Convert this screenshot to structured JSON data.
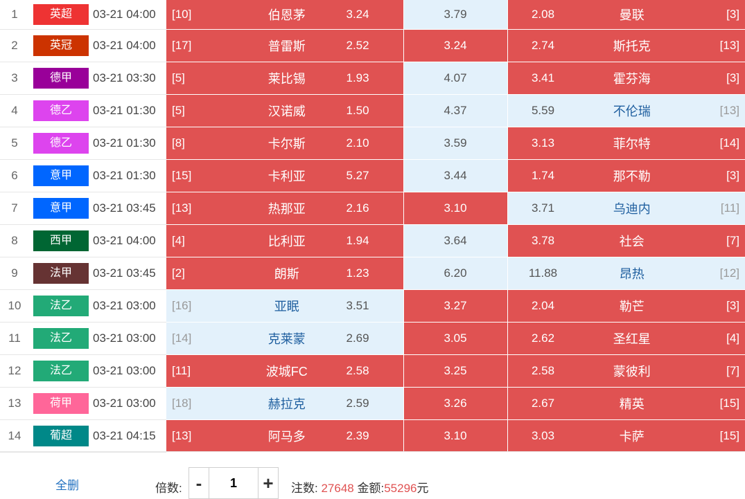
{
  "matches": [
    {
      "index": "1",
      "league": "英超",
      "league_color": "#ee3333",
      "time": "03-21 04:00",
      "home_rank": "[10]",
      "home": "伯恩茅",
      "home_odds": "3.24",
      "draw_odds": "3.79",
      "away_odds": "2.08",
      "away": "曼联",
      "away_rank": "[3]",
      "home_on": true,
      "draw_on": false,
      "away_on": true
    },
    {
      "index": "2",
      "league": "英冠",
      "league_color": "#cc3300",
      "time": "03-21 04:00",
      "home_rank": "[17]",
      "home": "普雷斯",
      "home_odds": "2.52",
      "draw_odds": "3.24",
      "away_odds": "2.74",
      "away": "斯托克",
      "away_rank": "[13]",
      "home_on": true,
      "draw_on": true,
      "away_on": true
    },
    {
      "index": "3",
      "league": "德甲",
      "league_color": "#990099",
      "time": "03-21 03:30",
      "home_rank": "[5]",
      "home": "莱比锡",
      "home_odds": "1.93",
      "draw_odds": "4.07",
      "away_odds": "3.41",
      "away": "霍芬海",
      "away_rank": "[3]",
      "home_on": true,
      "draw_on": false,
      "away_on": true
    },
    {
      "index": "4",
      "league": "德乙",
      "league_color": "#dd44ee",
      "time": "03-21 01:30",
      "home_rank": "[5]",
      "home": "汉诺威",
      "home_odds": "1.50",
      "draw_odds": "4.37",
      "away_odds": "5.59",
      "away": "不伦瑞",
      "away_rank": "[13]",
      "home_on": true,
      "draw_on": false,
      "away_on": false
    },
    {
      "index": "5",
      "league": "德乙",
      "league_color": "#dd44ee",
      "time": "03-21 01:30",
      "home_rank": "[8]",
      "home": "卡尔斯",
      "home_odds": "2.10",
      "draw_odds": "3.59",
      "away_odds": "3.13",
      "away": "菲尔特",
      "away_rank": "[14]",
      "home_on": true,
      "draw_on": false,
      "away_on": true
    },
    {
      "index": "6",
      "league": "意甲",
      "league_color": "#0066ff",
      "time": "03-21 01:30",
      "home_rank": "[15]",
      "home": "卡利亚",
      "home_odds": "5.27",
      "draw_odds": "3.44",
      "away_odds": "1.74",
      "away": "那不勒",
      "away_rank": "[3]",
      "home_on": true,
      "draw_on": false,
      "away_on": true
    },
    {
      "index": "7",
      "league": "意甲",
      "league_color": "#0066ff",
      "time": "03-21 03:45",
      "home_rank": "[13]",
      "home": "热那亚",
      "home_odds": "2.16",
      "draw_odds": "3.10",
      "away_odds": "3.71",
      "away": "乌迪内",
      "away_rank": "[11]",
      "home_on": true,
      "draw_on": true,
      "away_on": false
    },
    {
      "index": "8",
      "league": "西甲",
      "league_color": "#006633",
      "time": "03-21 04:00",
      "home_rank": "[4]",
      "home": "比利亚",
      "home_odds": "1.94",
      "draw_odds": "3.64",
      "away_odds": "3.78",
      "away": "社会",
      "away_rank": "[7]",
      "home_on": true,
      "draw_on": false,
      "away_on": true
    },
    {
      "index": "9",
      "league": "法甲",
      "league_color": "#663333",
      "time": "03-21 03:45",
      "home_rank": "[2]",
      "home": "朗斯",
      "home_odds": "1.23",
      "draw_odds": "6.20",
      "away_odds": "11.88",
      "away": "昂热",
      "away_rank": "[12]",
      "home_on": true,
      "draw_on": false,
      "away_on": false
    },
    {
      "index": "10",
      "league": "法乙",
      "league_color": "#22aa77",
      "time": "03-21 03:00",
      "home_rank": "[16]",
      "home": "亚眠",
      "home_odds": "3.51",
      "draw_odds": "3.27",
      "away_odds": "2.04",
      "away": "勒芒",
      "away_rank": "[3]",
      "home_on": false,
      "draw_on": true,
      "away_on": true
    },
    {
      "index": "11",
      "league": "法乙",
      "league_color": "#22aa77",
      "time": "03-21 03:00",
      "home_rank": "[14]",
      "home": "克莱蒙",
      "home_odds": "2.69",
      "draw_odds": "3.05",
      "away_odds": "2.62",
      "away": "圣红星",
      "away_rank": "[4]",
      "home_on": false,
      "draw_on": true,
      "away_on": true
    },
    {
      "index": "12",
      "league": "法乙",
      "league_color": "#22aa77",
      "time": "03-21 03:00",
      "home_rank": "[11]",
      "home": "波城FC",
      "home_odds": "2.58",
      "draw_odds": "3.25",
      "away_odds": "2.58",
      "away": "蒙彼利",
      "away_rank": "[7]",
      "home_on": true,
      "draw_on": true,
      "away_on": true
    },
    {
      "index": "13",
      "league": "荷甲",
      "league_color": "#ff6699",
      "time": "03-21 03:00",
      "home_rank": "[18]",
      "home": "赫拉克",
      "home_odds": "2.59",
      "draw_odds": "3.26",
      "away_odds": "2.67",
      "away": "精英",
      "away_rank": "[15]",
      "home_on": false,
      "draw_on": true,
      "away_on": true
    },
    {
      "index": "14",
      "league": "葡超",
      "league_color": "#008888",
      "time": "03-21 04:15",
      "home_rank": "[13]",
      "home": "阿马多",
      "home_odds": "2.39",
      "draw_odds": "3.10",
      "away_odds": "3.03",
      "away": "卡萨",
      "away_rank": "[15]",
      "home_on": true,
      "draw_on": true,
      "away_on": true
    }
  ],
  "footer": {
    "clear_all": "全删",
    "multiplier_label": "倍数:",
    "minus": "-",
    "plus": "+",
    "multiplier_value": "1",
    "bets_label": "注数:",
    "bets_value": "27648",
    "amount_label": "金额:",
    "amount_value": "55296",
    "currency": "元"
  }
}
